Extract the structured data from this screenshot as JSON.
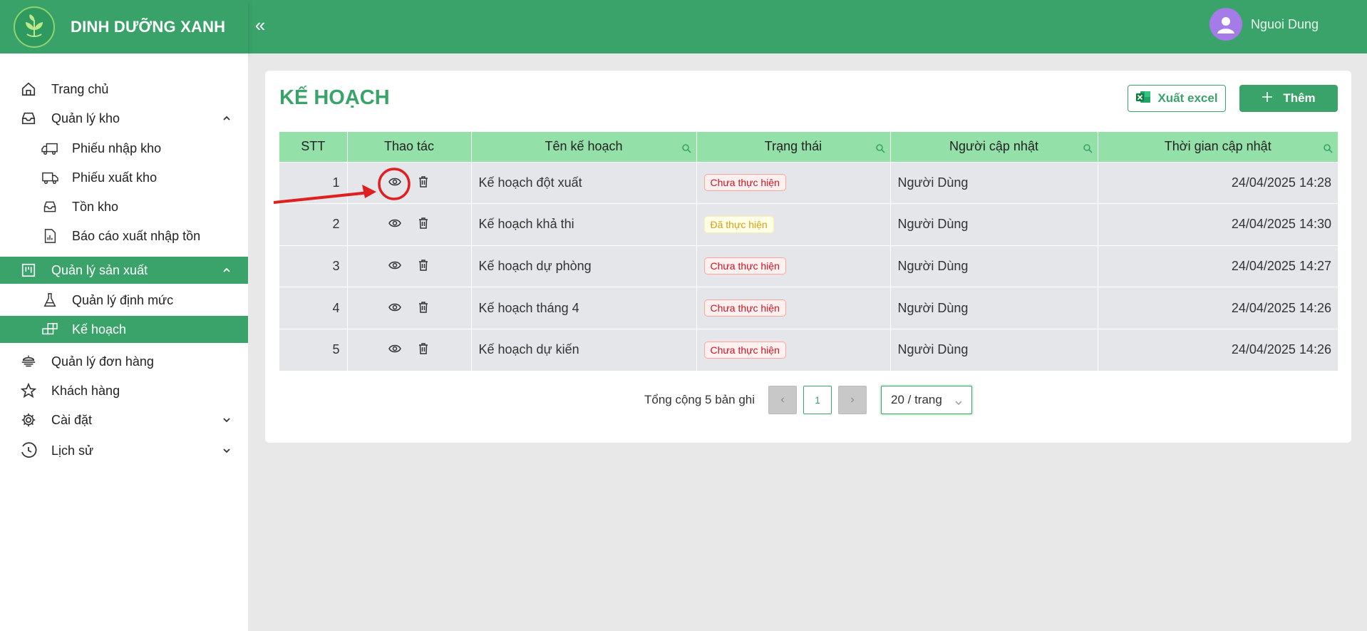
{
  "header": {
    "brand": "DINH DƯỠNG XANH",
    "collapse_icon": "double-chevron-left-icon",
    "user_name": "Nguoi Dung",
    "color": "#3aa36a"
  },
  "sidebar": {
    "items": [
      {
        "label": "Trang chủ",
        "icon": "home-icon"
      },
      {
        "label": "Quản lý kho",
        "icon": "inbox-icon"
      },
      {
        "label": "Phiếu nhập kho",
        "icon": "truck-in-icon"
      },
      {
        "label": "Phiếu xuất kho",
        "icon": "truck-out-icon"
      },
      {
        "label": "Tồn kho",
        "icon": "inbox-icon"
      },
      {
        "label": "Báo cáo xuất nhập tồn",
        "icon": "report-icon"
      },
      {
        "label": "Quản lý sản xuất",
        "icon": "project-icon"
      },
      {
        "label": "Quản lý định mức",
        "icon": "flask-icon"
      },
      {
        "label": "Kế hoạch",
        "icon": "blocks-icon"
      },
      {
        "label": "Quản lý đơn hàng",
        "icon": "order-icon"
      },
      {
        "label": "Khách hàng",
        "icon": "star-icon"
      },
      {
        "label": "Cài đặt",
        "icon": "gear-icon"
      },
      {
        "label": "Lịch sử",
        "icon": "clock-icon"
      }
    ]
  },
  "main": {
    "title": "KẾ HOẠCH",
    "export_label": "Xuất excel",
    "add_label": "Thêm",
    "table": {
      "headers": [
        "STT",
        "Thao tác",
        "Tên kế hoạch",
        "Trạng thái",
        "Người cập nhật",
        "Thời gian cập nhật"
      ],
      "rows": [
        {
          "stt": "1",
          "name": "Kế hoạch đột xuất",
          "status": "Chưa thực hiện",
          "status_color": "red",
          "user": "Người Dùng",
          "time": "24/04/2025 14:28"
        },
        {
          "stt": "2",
          "name": "Kế hoạch khả thi",
          "status": "Đã thực hiện",
          "status_color": "yellow",
          "user": "Người Dùng",
          "time": "24/04/2025 14:30"
        },
        {
          "stt": "3",
          "name": "Kế hoạch dự phòng",
          "status": "Chưa thực hiện",
          "status_color": "red",
          "user": "Người Dùng",
          "time": "24/04/2025 14:27"
        },
        {
          "stt": "4",
          "name": "Kế hoạch tháng 4",
          "status": "Chưa thực hiện",
          "status_color": "red",
          "user": "Người Dùng",
          "time": "24/04/2025 14:26"
        },
        {
          "stt": "5",
          "name": "Kế hoạch dự kiến",
          "status": "Chưa thực hiện",
          "status_color": "red",
          "user": "Người Dùng",
          "time": "24/04/2025 14:26"
        }
      ]
    },
    "pagination": {
      "total_text": "Tổng cộng 5 bản ghi",
      "current_page": "1",
      "page_size": "20 / trang"
    }
  }
}
